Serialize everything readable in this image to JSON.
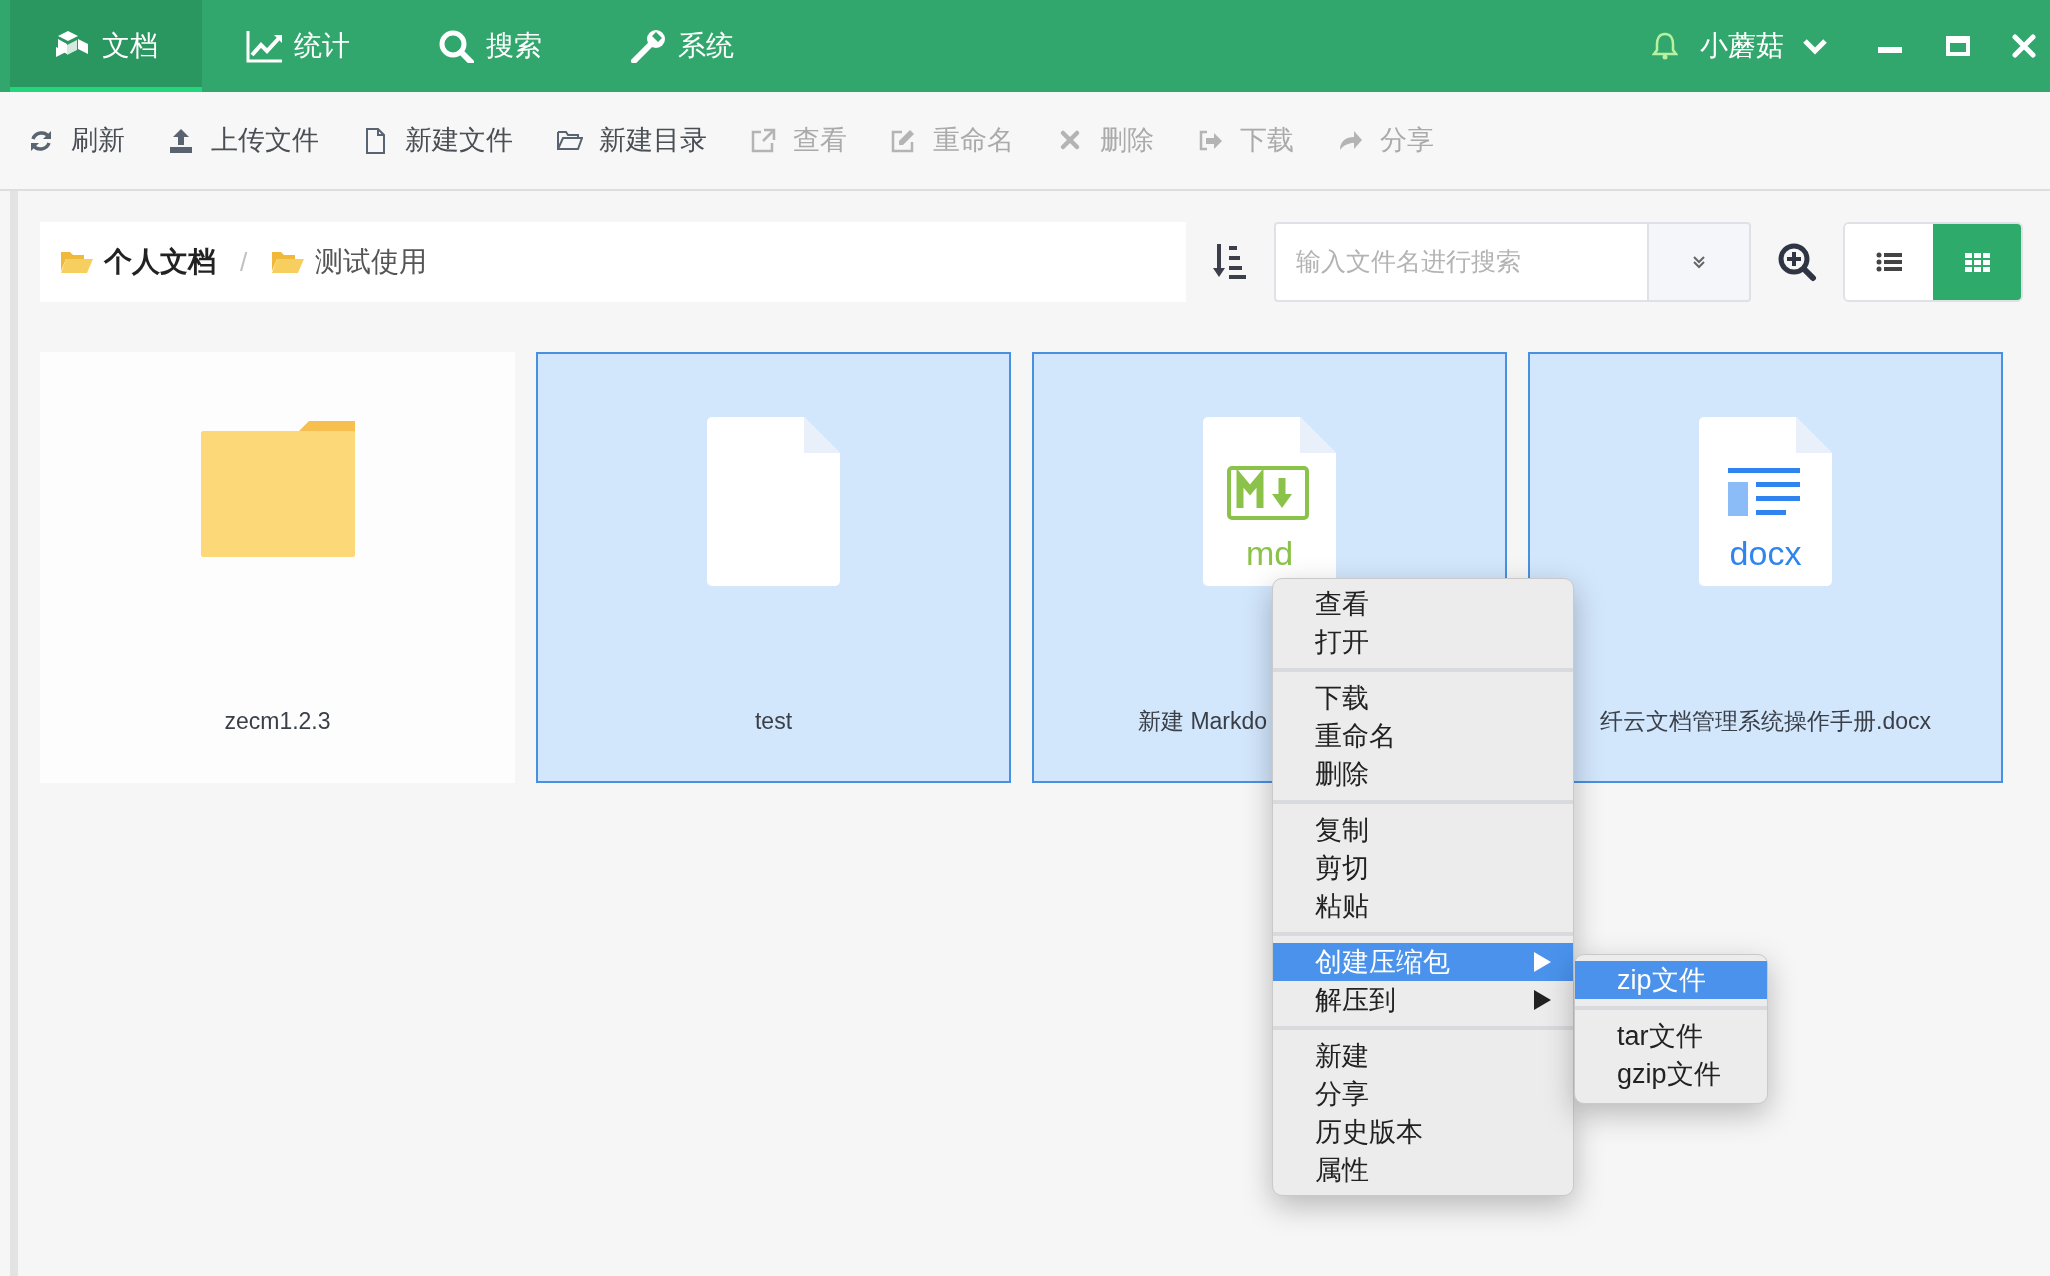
{
  "top_nav": {
    "tabs": [
      {
        "label": "文档",
        "selected": true
      },
      {
        "label": "统计",
        "selected": false
      },
      {
        "label": "搜索",
        "selected": false
      },
      {
        "label": "系统",
        "selected": false
      }
    ],
    "user": {
      "name": "小蘑菇"
    }
  },
  "toolbar": [
    {
      "label": "刷新",
      "disabled": false
    },
    {
      "label": "上传文件",
      "disabled": false
    },
    {
      "label": "新建文件",
      "disabled": false
    },
    {
      "label": "新建目录",
      "disabled": false
    },
    {
      "label": "查看",
      "disabled": true
    },
    {
      "label": "重命名",
      "disabled": true
    },
    {
      "label": "删除",
      "disabled": true
    },
    {
      "label": "下载",
      "disabled": true
    },
    {
      "label": "分享",
      "disabled": true
    }
  ],
  "breadcrumb": [
    {
      "label": "个人文档",
      "emphasized": true
    },
    {
      "label": "测试使用",
      "emphasized": false
    }
  ],
  "breadcrumb_separator": "/",
  "search": {
    "placeholder": "输入文件名进行搜索"
  },
  "view_toggle": [
    {
      "kind": "list",
      "selected": false
    },
    {
      "kind": "grid",
      "selected": true
    }
  ],
  "files": [
    {
      "name": "zecm1.2.3",
      "kind": "folder",
      "selected": false,
      "covered": false
    },
    {
      "name": "test",
      "kind": "file",
      "selected": true,
      "covered": false
    },
    {
      "name": "新建 Markdo",
      "kind": "markdown",
      "icon_label": "md",
      "selected": true,
      "covered": true
    },
    {
      "name": "纤云文档管理系统操作手册.docx",
      "kind": "docx",
      "icon_label": "docx",
      "selected": true,
      "covered": false
    }
  ],
  "context_menu": {
    "groups": [
      [
        {
          "label": "查看",
          "selected": false,
          "submenu": false
        },
        {
          "label": "打开",
          "selected": false,
          "submenu": false
        }
      ],
      [
        {
          "label": "下载",
          "selected": false,
          "submenu": false
        },
        {
          "label": "重命名",
          "selected": false,
          "submenu": false
        },
        {
          "label": "删除",
          "selected": false,
          "submenu": false
        }
      ],
      [
        {
          "label": "复制",
          "selected": false,
          "submenu": false
        },
        {
          "label": "剪切",
          "selected": false,
          "submenu": false
        },
        {
          "label": "粘贴",
          "selected": false,
          "submenu": false
        }
      ],
      [
        {
          "label": "创建压缩包",
          "selected": true,
          "submenu": true
        },
        {
          "label": "解压到",
          "selected": false,
          "submenu": true
        }
      ],
      [
        {
          "label": "新建",
          "selected": false,
          "submenu": false
        },
        {
          "label": "分享",
          "selected": false,
          "submenu": false
        },
        {
          "label": "历史版本",
          "selected": false,
          "submenu": false
        },
        {
          "label": "属性",
          "selected": false,
          "submenu": false
        }
      ]
    ]
  },
  "submenu": {
    "groups": [
      [
        {
          "label": "zip文件",
          "selected": true
        }
      ],
      [
        {
          "label": "tar文件",
          "selected": false
        },
        {
          "label": "gzip文件",
          "selected": false
        }
      ]
    ]
  }
}
